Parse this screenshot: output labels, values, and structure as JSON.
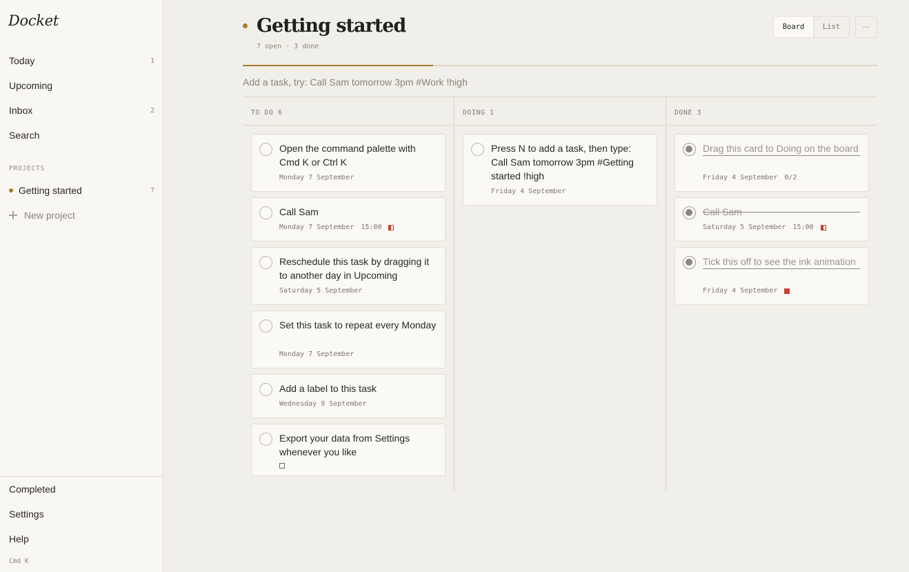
{
  "sidebar": {
    "brand": "Docket",
    "nav": [
      {
        "label": "Today",
        "count": "1"
      },
      {
        "label": "Upcoming",
        "count": ""
      },
      {
        "label": "Inbox",
        "count": "2"
      },
      {
        "label": "Search",
        "count": ""
      }
    ],
    "projects_label": "PROJECTS",
    "projects": [
      {
        "label": "Getting started",
        "count": "7",
        "color": "#a97c2a"
      }
    ],
    "new_project": "New project",
    "footer": [
      "Completed",
      "Settings",
      "Help"
    ],
    "shortcut": "Cmd K"
  },
  "header": {
    "title": "Getting started",
    "stats": "7 open · 3 done",
    "view_board": "Board",
    "view_list": "List",
    "more": "···",
    "progress": 0.3
  },
  "add_task": {
    "placeholder": "Add a task, try: Call Sam tomorrow 3pm #Work !high"
  },
  "colors": {
    "accent": "#a97c2a",
    "priority": "#c7402d"
  },
  "columns": [
    {
      "label": "TO DO 6",
      "cards": [
        {
          "title": "Open the command palette with Cmd K or Ctrl K",
          "date": "Monday 7 September",
          "time": "",
          "extra": "",
          "priority": ""
        },
        {
          "title": "Call Sam",
          "date": "Monday 7 September",
          "time": "15:00",
          "extra": "",
          "priority": "medium"
        },
        {
          "title": "Reschedule this task by dragging it to another day in Upcoming",
          "date": "Saturday 5 September",
          "time": "",
          "extra": "",
          "priority": ""
        },
        {
          "title": "Set this task to repeat every Monday",
          "date": "Monday 7 September",
          "time": "",
          "extra": "",
          "priority": ""
        },
        {
          "title": "Add a label to this task",
          "date": "Wednesday 9 September",
          "time": "",
          "extra": "",
          "priority": ""
        },
        {
          "title": "Export your data from Settings whenever you like",
          "date": "",
          "time": "",
          "extra": "",
          "priority": "none"
        }
      ]
    },
    {
      "label": "DOING 1",
      "cards": [
        {
          "title": "Press N to add a task, then type: Call Sam tomorrow 3pm #Getting started !high",
          "date": "Friday 4 September",
          "time": "",
          "extra": "",
          "priority": ""
        }
      ]
    },
    {
      "label": "DONE 3",
      "cards": [
        {
          "title": "Drag this card to Doing on the board",
          "date": "Friday 4 September",
          "time": "",
          "extra": "0/2",
          "priority": "",
          "done": true
        },
        {
          "title": "Call Sam",
          "date": "Saturday 5 September",
          "time": "15:00",
          "extra": "",
          "priority": "medium",
          "done": true
        },
        {
          "title": "Tick this off to see the ink animation",
          "date": "Friday 4 September",
          "time": "",
          "extra": "",
          "priority": "high",
          "done": true
        }
      ]
    }
  ]
}
